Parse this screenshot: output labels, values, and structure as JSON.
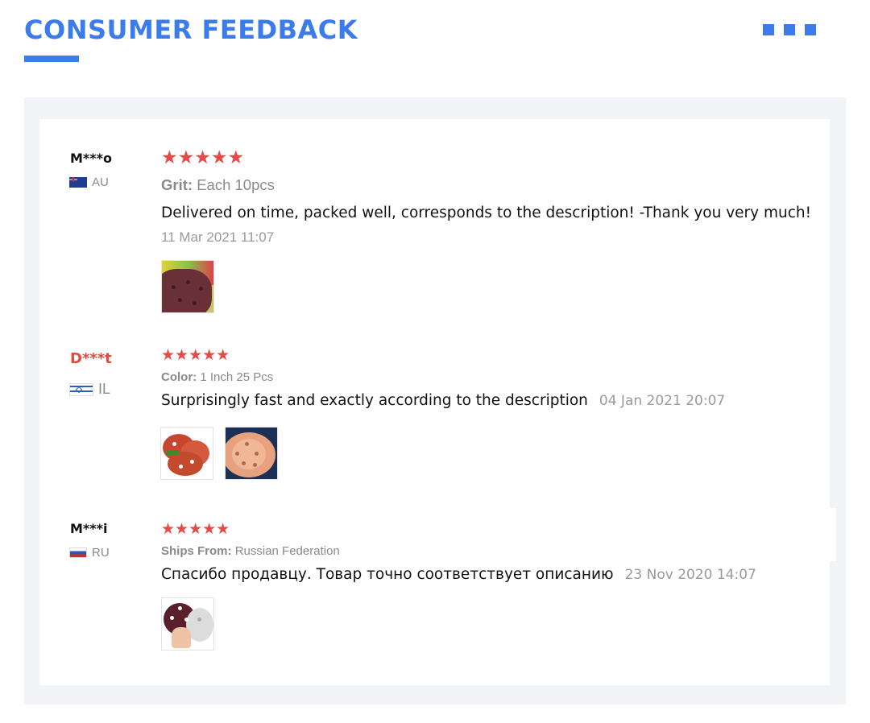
{
  "header": {
    "title": "CONSUMER FEEDBACK",
    "accent_color": "#3b7bec"
  },
  "reviews": [
    {
      "user": "M***o",
      "country": "AU",
      "flag_icon": "australia-flag-icon",
      "rating": 5,
      "stars": "★★★★★",
      "attribute_label": "Grit:",
      "attribute_value": "Each 10pcs",
      "text": "Delivered on time, packed well, corresponds to the description! -Thank you very much!",
      "date": "11 Mar 2021 11:07",
      "photos": 1
    },
    {
      "user": "D***t",
      "country": "IL",
      "flag_icon": "israel-flag-icon",
      "rating": 5,
      "stars": "★★★★★",
      "attribute_label": "Color:",
      "attribute_value": "1 Inch 25 Pcs",
      "text": "Surprisingly fast and exactly according to the description",
      "date": "04 Jan 2021 20:07",
      "photos": 2
    },
    {
      "user": "M***i",
      "country": "RU",
      "flag_icon": "russia-flag-icon",
      "rating": 5,
      "stars": "★★★★★",
      "attribute_label": "Ships From:",
      "attribute_value": "Russian Federation",
      "text": "Спасибо продавцу. Товар точно соответствует описанию",
      "date": "23 Nov 2020 14:07",
      "photos": 1
    }
  ],
  "colors": {
    "star": "#e74a46",
    "name_highlight": "#e04a3f",
    "panel_bg": "#f2f4f8"
  }
}
